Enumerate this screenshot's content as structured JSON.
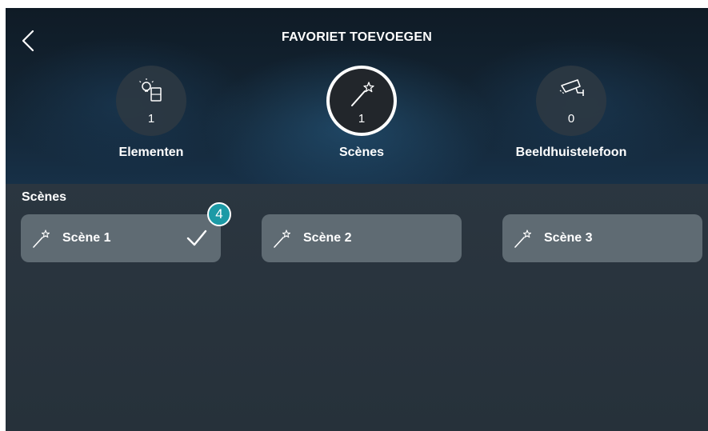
{
  "header": {
    "title": "FAVORIET TOEVOEGEN",
    "back_icon": "chevron-left-icon"
  },
  "categories": [
    {
      "label": "Elementen",
      "count": "1",
      "icon": "lightbulb-switch-icon",
      "selected": false
    },
    {
      "label": "Scènes",
      "count": "1",
      "icon": "magic-wand-icon",
      "selected": true
    },
    {
      "label": "Beeldhuistelefoon",
      "count": "0",
      "icon": "security-camera-icon",
      "selected": false
    }
  ],
  "section": {
    "title": "Scènes"
  },
  "scenes": [
    {
      "label": "Scène 1",
      "icon": "magic-wand-icon",
      "checked": true
    },
    {
      "label": "Scène 2",
      "icon": "magic-wand-icon",
      "checked": false
    },
    {
      "label": "Scène 3",
      "icon": "magic-wand-icon",
      "checked": false
    }
  ],
  "annotation": {
    "step_number": "4"
  },
  "colors": {
    "header_bg": "#132433",
    "body_bg": "#2b3640",
    "card_bg": "#5f6b73",
    "badge": "#1c9aa6",
    "text": "#ffffff"
  }
}
